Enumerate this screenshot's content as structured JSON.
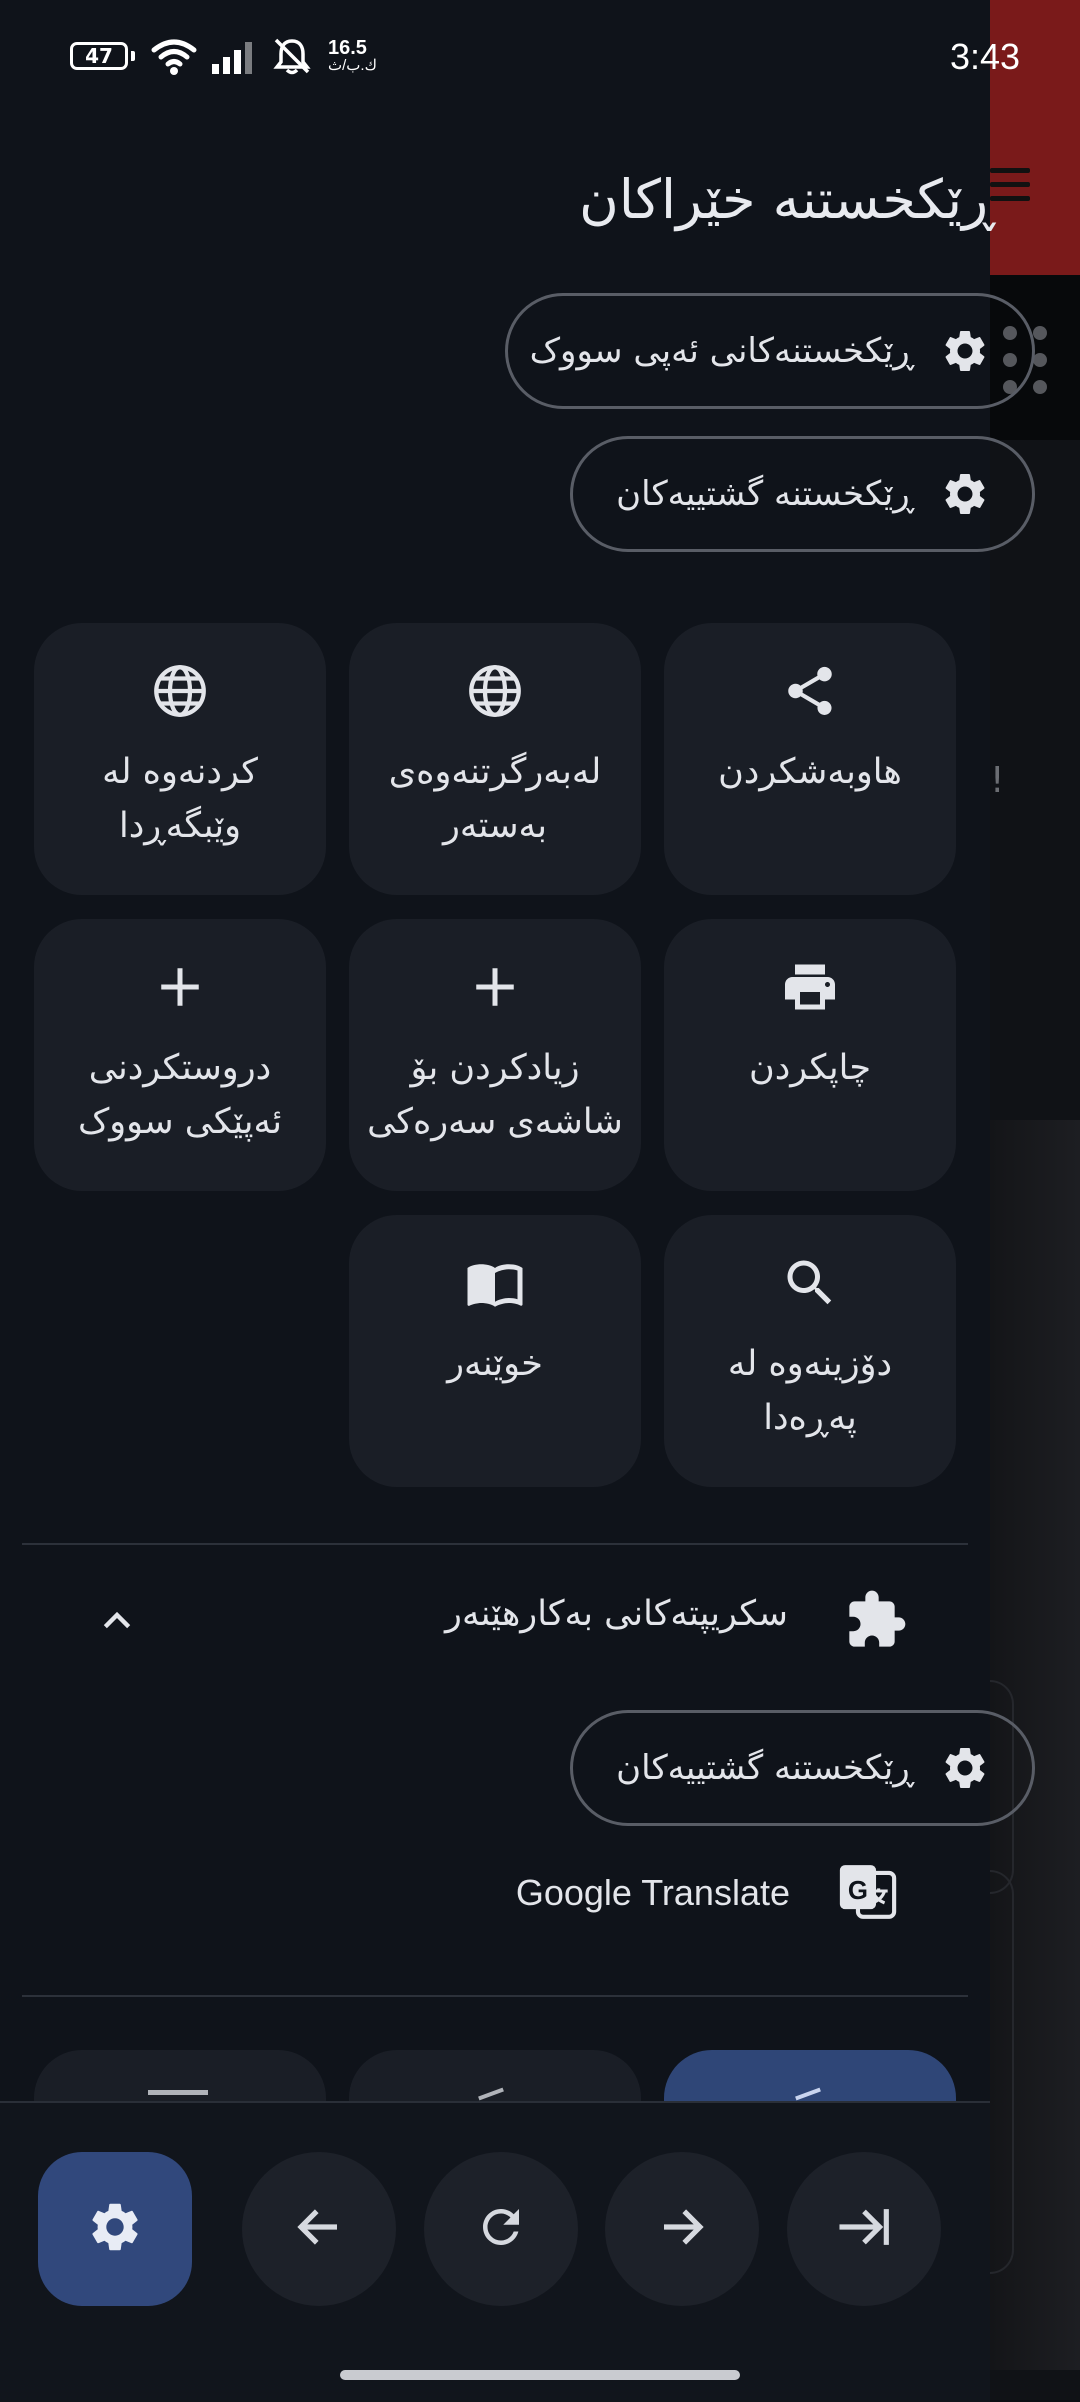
{
  "status": {
    "battery": "47",
    "net_speed_value": "16.5",
    "net_speed_unit": "ك.ب/ث",
    "time": "3:43"
  },
  "panel": {
    "title": "ڕێکخستنە خێراکان",
    "light_app_settings": "ڕێکخستنەکانی ئەپی سووک",
    "general_settings": "ڕێکخستنە گشتییەکان"
  },
  "tiles": [
    {
      "label": "هاوبەشکردن",
      "icon": "share-icon"
    },
    {
      "label": "لەبەرگرتنەوەی بەستەر",
      "icon": "globe-icon"
    },
    {
      "label": "کردنەوە لە وێبگەڕدا",
      "icon": "globe-icon"
    },
    {
      "label": "چاپکردن",
      "icon": "printer-icon"
    },
    {
      "label": "زیادکردن بۆ شاشەی سەرەکی",
      "icon": "plus-icon"
    },
    {
      "label": "دروستکردنی ئەپێکی سووک",
      "icon": "plus-icon"
    },
    {
      "label": "دۆزینەوە لە پەڕەدا",
      "icon": "search-icon"
    },
    {
      "label": "خوێنەر",
      "icon": "book-icon"
    }
  ],
  "extensions": {
    "header": "سکریپتەکانی بەکارهێنەر",
    "general_settings": "ڕێکخستنە گشتییەکان",
    "items": [
      {
        "label": "Google Translate",
        "icon": "google-translate-icon"
      }
    ]
  },
  "bottom_nav": [
    "gear-icon",
    "arrow-left-icon",
    "reload-icon",
    "arrow-right-icon",
    "arrow-to-end-icon"
  ]
}
